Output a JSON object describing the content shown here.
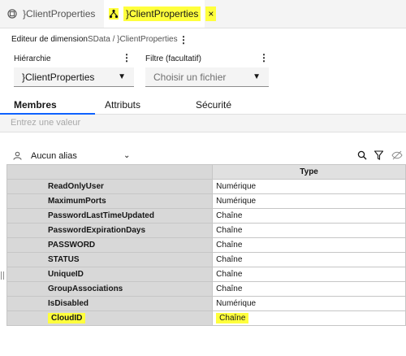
{
  "tabs": [
    {
      "label": "}ClientProperties",
      "icon": "dimension-icon"
    },
    {
      "label": "}ClientProperties",
      "icon": "hierarchy-icon",
      "close": "×"
    }
  ],
  "header": {
    "title": "Editeur de dimension",
    "breadcrumb": "SData / }ClientProperties"
  },
  "hierarchy": {
    "label": "Hiérarchie",
    "value": "}ClientProperties"
  },
  "filter": {
    "label": "Filtre (facultatif)",
    "placeholder": "Choisir un fichier"
  },
  "subtabs": [
    "Membres",
    "Attributs",
    "Sécurité"
  ],
  "search": {
    "placeholder": "Entrez une valeur"
  },
  "alias": {
    "value": "Aucun alias"
  },
  "table": {
    "header": "Type",
    "rows": [
      {
        "name": "ReadOnlyUser",
        "type": "Numérique"
      },
      {
        "name": "MaximumPorts",
        "type": "Numérique"
      },
      {
        "name": "PasswordLastTimeUpdated",
        "type": "Chaîne"
      },
      {
        "name": "PasswordExpirationDays",
        "type": "Chaîne"
      },
      {
        "name": "PASSWORD",
        "type": "Chaîne"
      },
      {
        "name": "STATUS",
        "type": "Chaîne"
      },
      {
        "name": "UniqueID",
        "type": "Chaîne"
      },
      {
        "name": "GroupAssociations",
        "type": "Chaîne"
      },
      {
        "name": "IsDisabled",
        "type": "Numérique"
      },
      {
        "name": "CloudID",
        "type": "Chaîne"
      }
    ]
  },
  "colors": {
    "highlight": "#ffff3c",
    "accent": "#0f62fe"
  }
}
